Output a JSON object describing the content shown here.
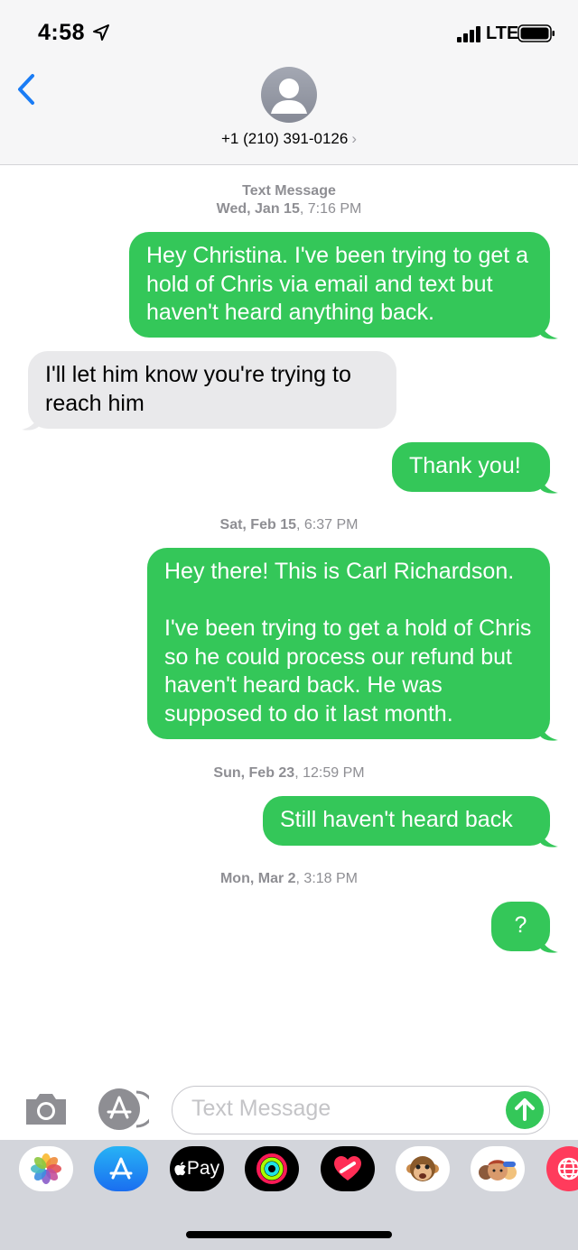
{
  "status_bar": {
    "time": "4:58",
    "network": "LTE",
    "location_icon": "location-arrow-icon",
    "signal_icon": "cellular-signal-icon",
    "battery_icon": "battery-icon"
  },
  "header": {
    "contact": "+1 (210) 391-0126",
    "disclosure": "›",
    "back_icon": "chevron-left-icon",
    "avatar_icon": "person-silhouette-icon"
  },
  "thread": [
    {
      "type": "timestamp",
      "label": "Text Message",
      "day": "Wed, Jan 15",
      "time": "7:16 PM"
    },
    {
      "type": "sent",
      "text": "Hey Christina. I've been trying to get a hold of Chris via email and text but haven't heard anything back."
    },
    {
      "type": "received",
      "text": "I'll let him know you're trying to reach him"
    },
    {
      "type": "sent",
      "text": "Thank you!"
    },
    {
      "type": "timestamp",
      "day": "Sat, Feb 15",
      "time": "6:37 PM"
    },
    {
      "type": "sent",
      "text": "Hey there! This is Carl Richardson.\n\nI've been trying to get a hold of Chris so he could process our refund but haven't heard back. He was supposed to do it last month."
    },
    {
      "type": "timestamp",
      "day": "Sun, Feb 23",
      "time": "12:59 PM"
    },
    {
      "type": "sent",
      "text": "Still haven't heard back"
    },
    {
      "type": "timestamp",
      "day": "Mon, Mar 2",
      "time": "3:18 PM"
    },
    {
      "type": "sent",
      "text": "?"
    }
  ],
  "input": {
    "placeholder": "Text Message",
    "camera_icon": "camera-icon",
    "apps_icon": "app-store-icon",
    "send_icon": "arrow-up-icon"
  },
  "app_drawer": [
    {
      "name": "photos-app-icon"
    },
    {
      "name": "app-store-app-icon"
    },
    {
      "name": "apple-pay-app-icon",
      "label": "Pay"
    },
    {
      "name": "activity-app-icon"
    },
    {
      "name": "digital-touch-app-icon"
    },
    {
      "name": "animoji-app-icon"
    },
    {
      "name": "memoji-app-icon"
    },
    {
      "name": "web-search-app-icon"
    }
  ],
  "colors": {
    "sent_bubble": "#34c759",
    "received_bubble": "#e9e9eb",
    "accent_blue": "#1a7cf5",
    "timestamp": "#8e8e93",
    "drawer": "#d3d5db"
  }
}
